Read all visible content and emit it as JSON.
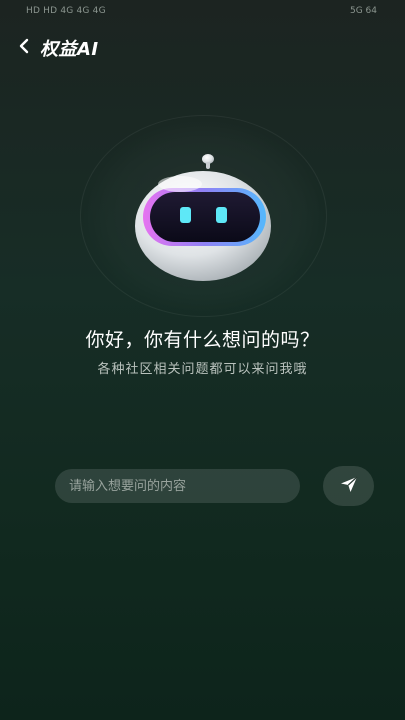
{
  "status_bar": {
    "left_text": "HD HD 4G 4G 4G",
    "right_text": "5G 64"
  },
  "header": {
    "title": "权益AI"
  },
  "hero": {
    "greeting": "你好，你有什么想问的吗？",
    "subtitle": "各种社区相关问题都可以来问我哦"
  },
  "chat_input": {
    "placeholder": "请输入想要问的内容",
    "value": ""
  },
  "icons": {
    "back": "chevron-left-icon",
    "send": "send-icon",
    "mascot": "robot-mascot"
  },
  "colors": {
    "background_top": "#1c2421",
    "background_bottom": "#0d241b",
    "robot_glow_left": "#e66cf0",
    "robot_glow_right": "#4fb7ff",
    "robot_eyes": "#5ee8f7"
  }
}
